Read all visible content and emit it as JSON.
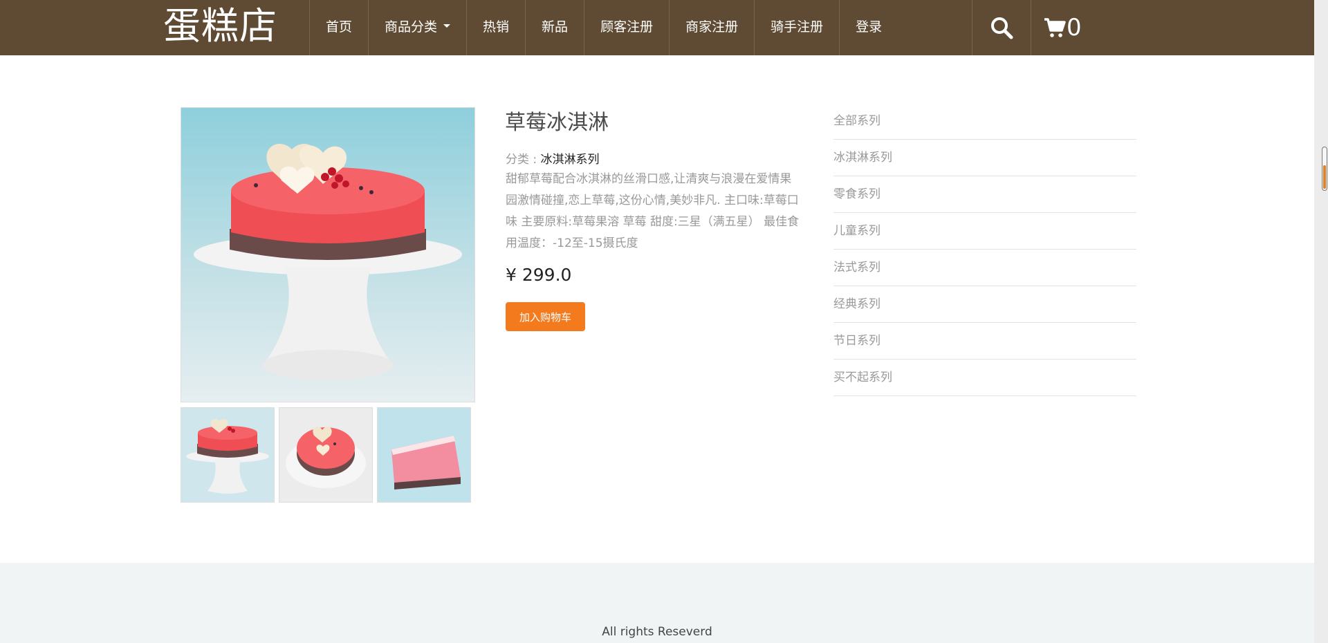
{
  "header": {
    "brand": "蛋糕店",
    "nav": {
      "home": "首页",
      "categories": "商品分类",
      "hot": "热销",
      "new": "新品",
      "customer_register": "顾客注册",
      "merchant_register": "商家注册",
      "rider_register": "骑手注册",
      "login": "登录"
    },
    "cart_count": "0"
  },
  "product": {
    "title": "草莓冰淇淋",
    "category_label": "分类 : ",
    "category_value": "冰淇淋系列",
    "description": "甜郁草莓配合冰淇淋的丝滑口感,让清爽与浪漫在爱情果园激情碰撞,恋上草莓,这份心情,美妙非凡. 主口味:草莓口味 主要原料:草莓果溶 草莓 甜度:三星（满五星） 最佳食用温度：-12至-15摄氏度",
    "price": "¥ 299.0",
    "add_to_cart": "加入购物车"
  },
  "sidebar": {
    "items": [
      "全部系列",
      "冰淇淋系列",
      "零食系列",
      "儿童系列",
      "法式系列",
      "经典系列",
      "节日系列",
      "买不起系列"
    ]
  },
  "footer": {
    "text": "All rights Reseverd"
  },
  "colors": {
    "header_bg": "#5f4b33",
    "accent": "#f37a1d",
    "muted_text": "#999999",
    "footer_bg": "#f1f4f5"
  },
  "icons": [
    "search-icon",
    "cart-icon",
    "chevron-down-icon"
  ]
}
